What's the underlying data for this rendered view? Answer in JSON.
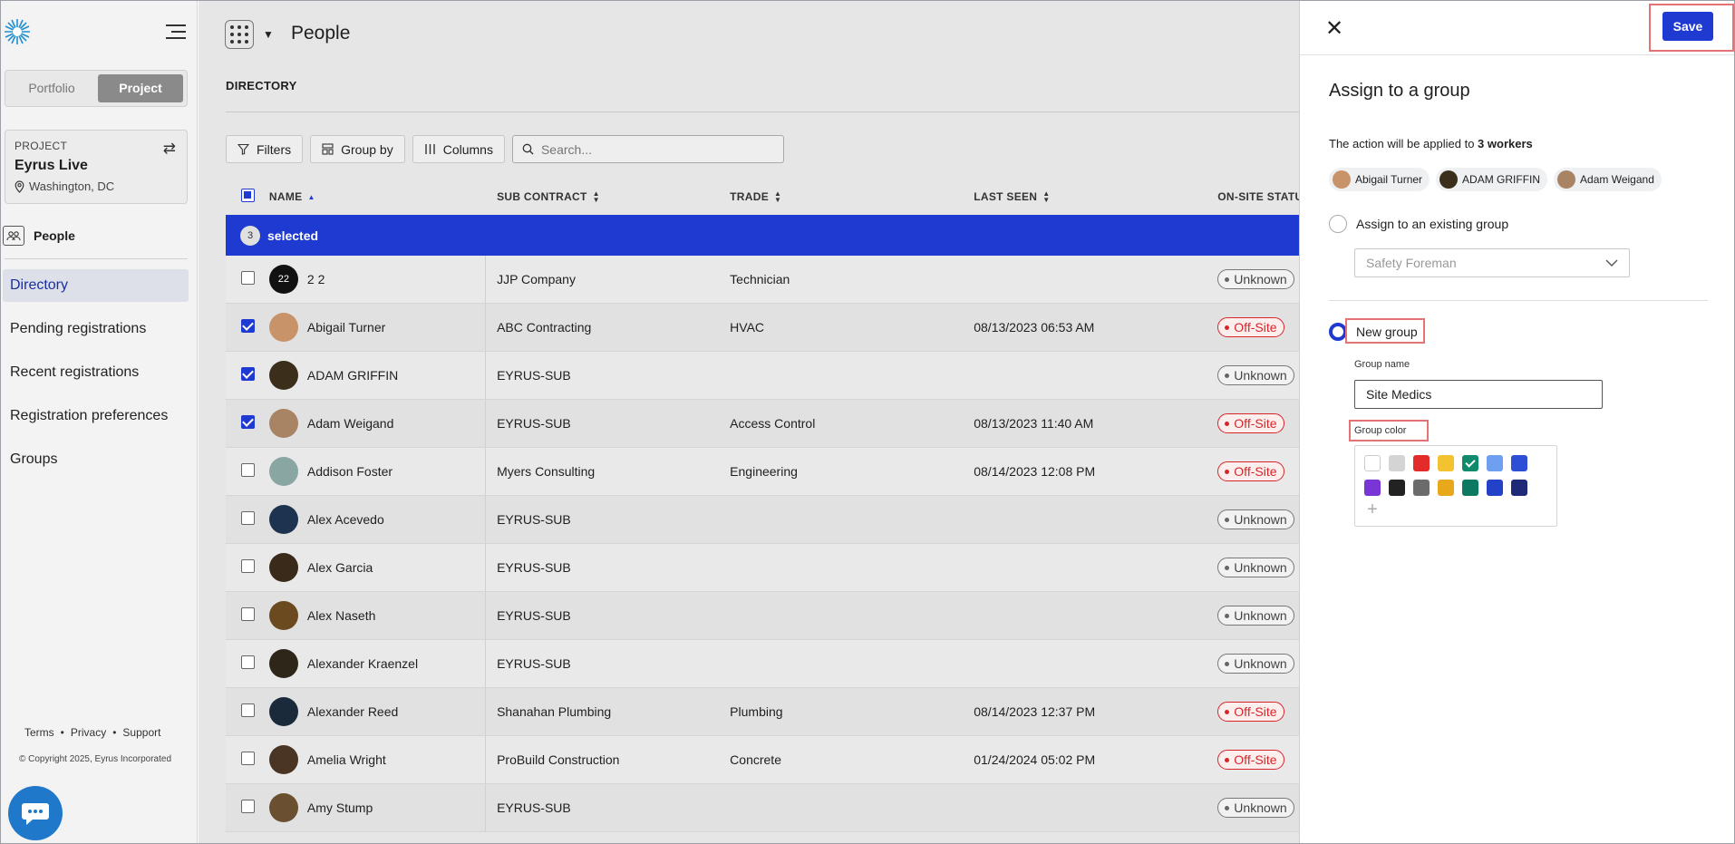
{
  "sidebar": {
    "switcher": [
      "Portfolio",
      "Project"
    ],
    "project": {
      "label": "PROJECT",
      "name": "Eyrus Live",
      "location": "Washington, DC"
    },
    "section_label": "People",
    "nav_items": [
      "Directory",
      "Pending registrations",
      "Recent registrations",
      "Registration preferences",
      "Groups"
    ],
    "footer_links": [
      "Terms",
      "Privacy",
      "Support"
    ],
    "copyright": "© Copyright 2025, Eyrus Incorporated"
  },
  "header": {
    "title": "People",
    "section": "DIRECTORY"
  },
  "toolbar": {
    "filters": "Filters",
    "group_by": "Group by",
    "columns": "Columns",
    "search_placeholder": "Search..."
  },
  "table": {
    "columns": [
      "NAME",
      "SUB CONTRACT",
      "TRADE",
      "LAST SEEN",
      "ON-SITE STATU"
    ],
    "selected_count": "3",
    "selected_label": "selected",
    "rows": [
      {
        "avatar": "22",
        "avatar_color": "#111111",
        "name": "2 2",
        "sub": "JJP Company",
        "trade": "Technician",
        "seen": "",
        "status": "Unknown",
        "checked": false
      },
      {
        "avatar": "",
        "avatar_color": "#c9936a",
        "name": "Abigail Turner",
        "sub": "ABC Contracting",
        "trade": "HVAC",
        "seen": "08/13/2023 06:53 AM",
        "status": "Off-Site",
        "checked": true
      },
      {
        "avatar": "",
        "avatar_color": "#3b2f1c",
        "name": "ADAM GRIFFIN",
        "sub": "EYRUS-SUB",
        "trade": "",
        "seen": "",
        "status": "Unknown",
        "checked": true
      },
      {
        "avatar": "",
        "avatar_color": "#a88364",
        "name": "Adam Weigand",
        "sub": "EYRUS-SUB",
        "trade": "Access Control",
        "seen": "08/13/2023 11:40 AM",
        "status": "Off-Site",
        "checked": true
      },
      {
        "avatar": "",
        "avatar_color": "#8aa6a3",
        "name": "Addison Foster",
        "sub": "Myers Consulting",
        "trade": "Engineering",
        "seen": "08/14/2023 12:08 PM",
        "status": "Off-Site",
        "checked": false
      },
      {
        "avatar": "",
        "avatar_color": "#1e3350",
        "name": "Alex Acevedo",
        "sub": "EYRUS-SUB",
        "trade": "",
        "seen": "",
        "status": "Unknown",
        "checked": false
      },
      {
        "avatar": "",
        "avatar_color": "#3a2a1a",
        "name": "Alex Garcia",
        "sub": "EYRUS-SUB",
        "trade": "",
        "seen": "",
        "status": "Unknown",
        "checked": false
      },
      {
        "avatar": "",
        "avatar_color": "#6b4a20",
        "name": "Alex Naseth",
        "sub": "EYRUS-SUB",
        "trade": "",
        "seen": "",
        "status": "Unknown",
        "checked": false
      },
      {
        "avatar": "",
        "avatar_color": "#2e2618",
        "name": "Alexander Kraenzel",
        "sub": "EYRUS-SUB",
        "trade": "",
        "seen": "",
        "status": "Unknown",
        "checked": false
      },
      {
        "avatar": "",
        "avatar_color": "#1a2a3a",
        "name": "Alexander Reed",
        "sub": "Shanahan Plumbing",
        "trade": "Plumbing",
        "seen": "08/14/2023 12:37 PM",
        "status": "Off-Site",
        "checked": false
      },
      {
        "avatar": "",
        "avatar_color": "#4a3424",
        "name": "Amelia Wright",
        "sub": "ProBuild Construction",
        "trade": "Concrete",
        "seen": "01/24/2024 05:02 PM",
        "status": "Off-Site",
        "checked": false
      },
      {
        "avatar": "",
        "avatar_color": "#6a5030",
        "name": "Amy Stump",
        "sub": "EYRUS-SUB",
        "trade": "",
        "seen": "",
        "status": "Unknown",
        "checked": false
      }
    ]
  },
  "panel": {
    "save_label": "Save",
    "title": "Assign to a group",
    "applied_prefix": "The action will be applied to ",
    "applied_count": "3 workers",
    "chips": [
      {
        "name": "Abigail Turner",
        "color": "#c9936a"
      },
      {
        "name": "ADAM GRIFFIN",
        "color": "#3b2f1c"
      },
      {
        "name": "Adam Weigand",
        "color": "#a88364"
      }
    ],
    "existing_label": "Assign to an existing group",
    "existing_placeholder": "Safety Foreman",
    "new_label": "New group",
    "group_name_label": "Group name",
    "group_name_value": "Site Medics",
    "group_color_label": "Group color",
    "colors": [
      "#ffffff",
      "#d4d4d4",
      "#e32b2b",
      "#f2c230",
      "#0f8a6c",
      "#6e9ff0",
      "#2c4fd6",
      "#7a35d6",
      "#222222",
      "#6b6b6b",
      "#e8a81c",
      "#0c7a62",
      "#2442c8",
      "#1e2a78"
    ],
    "selected_color_index": 4,
    "add_symbol": "+"
  }
}
